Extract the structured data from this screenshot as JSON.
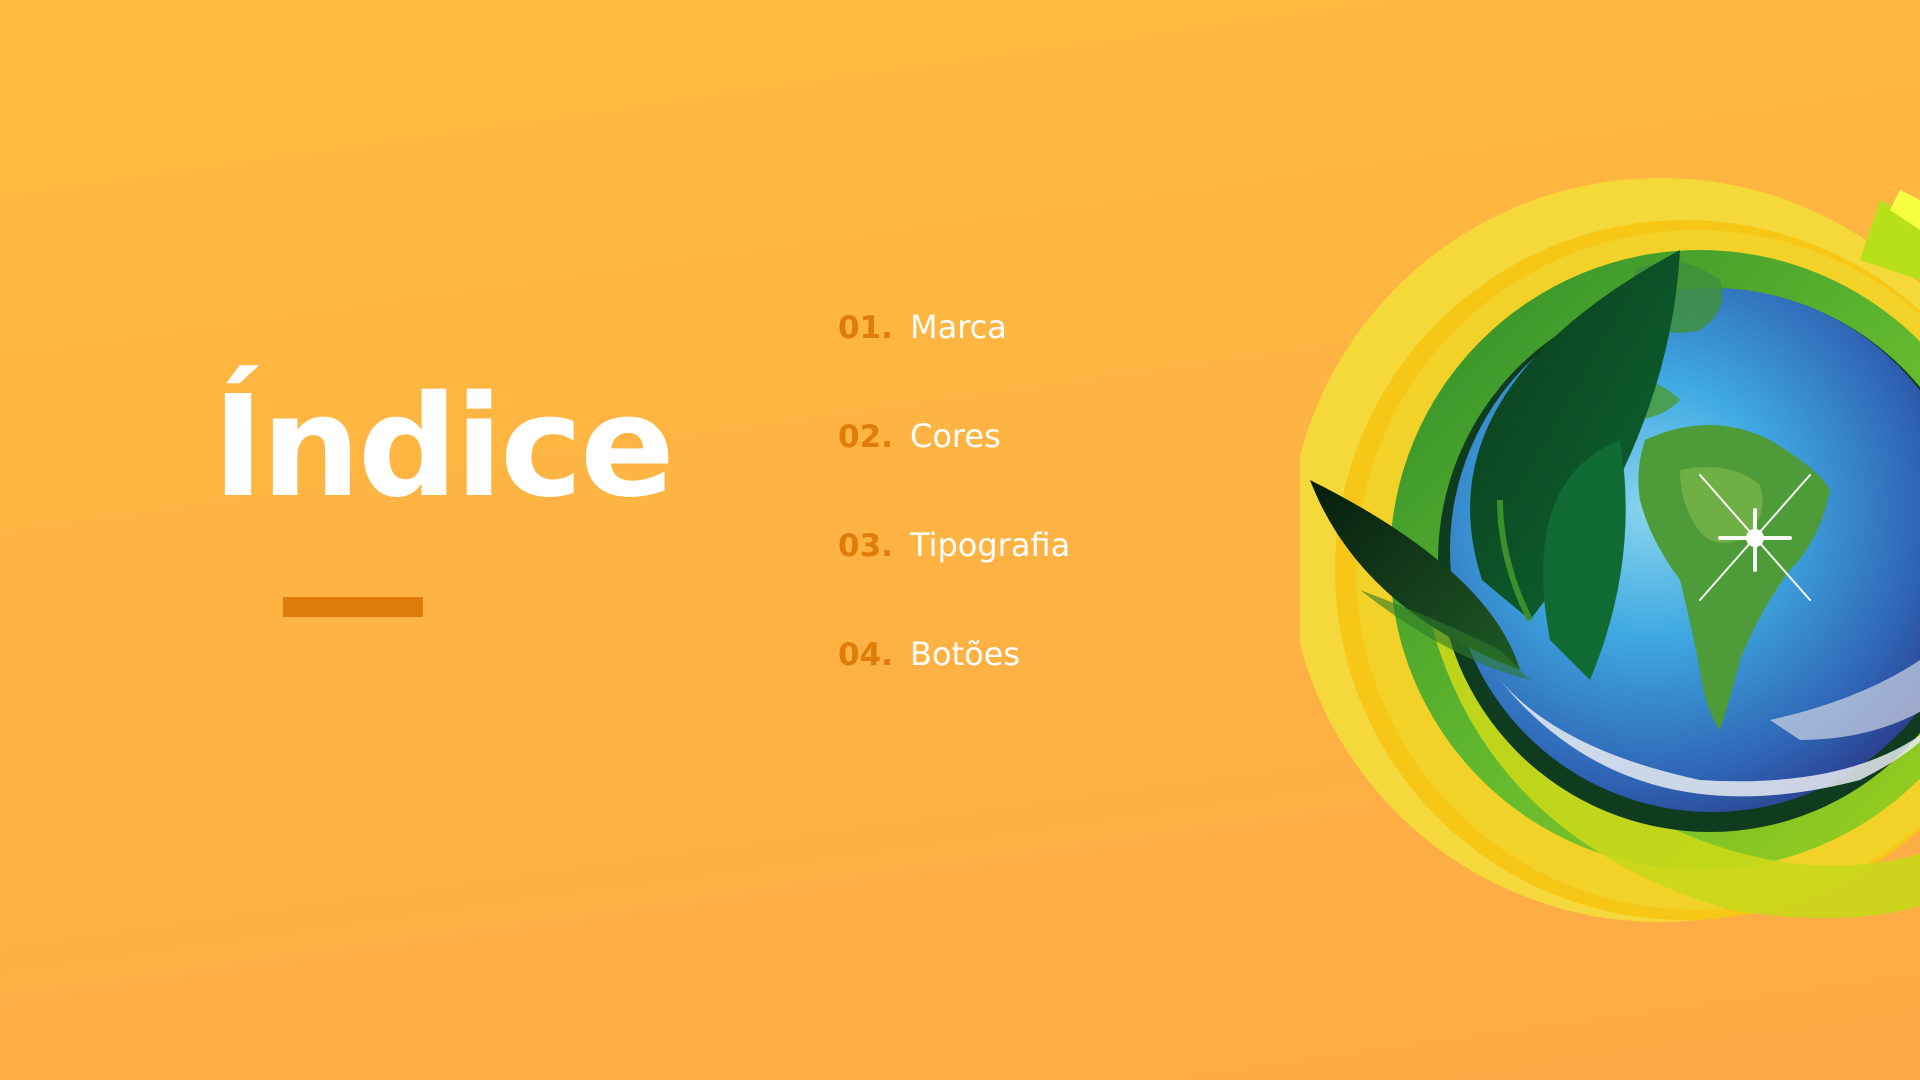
{
  "slide": {
    "title": "Índice"
  },
  "toc": {
    "items": [
      {
        "number": "01.",
        "label": "Marca"
      },
      {
        "number": "02.",
        "label": "Cores"
      },
      {
        "number": "03.",
        "label": "Tipografia"
      },
      {
        "number": "04.",
        "label": "Botões"
      }
    ]
  },
  "colors": {
    "background": "#FEB243",
    "accent": "#E07C0A",
    "text": "#FFFFFF"
  },
  "icons": {
    "logo": "globe-leaf-logo-icon"
  }
}
